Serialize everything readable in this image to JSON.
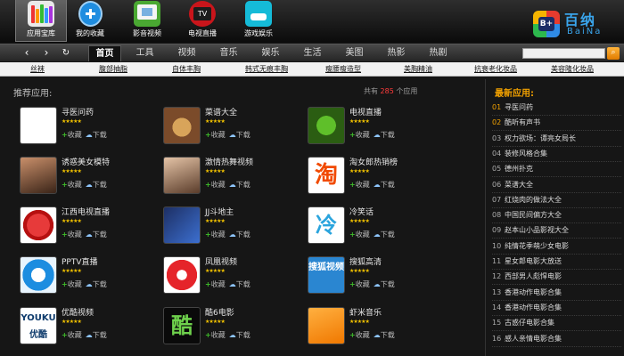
{
  "toolbar": {
    "apps": [
      {
        "label": "应用宝库",
        "icon": "books-icon",
        "active": true
      },
      {
        "label": "我的收藏",
        "icon": "add-favorite-icon"
      },
      {
        "label": "影音视频",
        "icon": "video-icon"
      },
      {
        "label": "电视直播",
        "icon": "tv-icon",
        "badge": "TV"
      },
      {
        "label": "游戏娱乐",
        "icon": "game-icon"
      }
    ],
    "logo": {
      "cn": "百纳",
      "en": "BaiNa",
      "mark": "B+"
    }
  },
  "nav": {
    "back": "‹",
    "forward": "›",
    "refresh": "↻",
    "tabs": [
      "首页",
      "工具",
      "视频",
      "音乐",
      "娱乐",
      "生活",
      "美图",
      "热影",
      "热剧"
    ],
    "active_tab": "首页",
    "search_value": "",
    "search_icon": "search-icon"
  },
  "subnav": [
    "丝袜",
    "腹部抽脂",
    "自体丰胸",
    "韩式无痕丰胸",
    "瘦腰瘦造型",
    "美胸精油",
    "抗衰老化妆品",
    "美容隆化妆品"
  ],
  "recommend": {
    "title": "推荐应用:",
    "count_prefix": "共有",
    "count": "285",
    "count_suffix": "个应用",
    "rating": "★★★★★",
    "fav_label": "收藏",
    "dl_label": "下载",
    "apps": [
      {
        "name": "寻医问药",
        "icon": "medical-icon"
      },
      {
        "name": "菜谱大全",
        "icon": "recipe-icon"
      },
      {
        "name": "电视直播",
        "icon": "tv-live-icon"
      },
      {
        "name": "诱惑美女模特",
        "icon": "model-photo-icon"
      },
      {
        "name": "激情热舞视频",
        "icon": "dance-video-icon"
      },
      {
        "name": "淘女郎热销榜",
        "icon": "taobao-icon",
        "glyph": "淘"
      },
      {
        "name": "江西电视直播",
        "icon": "jiangxi-tv-icon"
      },
      {
        "name": "JJ斗地主",
        "icon": "poker-icon"
      },
      {
        "name": "冷笑话",
        "icon": "cold-joke-icon",
        "glyph": "冷"
      },
      {
        "name": "PPTV直播",
        "icon": "pptv-icon"
      },
      {
        "name": "凤凰视频",
        "icon": "phoenix-icon"
      },
      {
        "name": "搜狐高清",
        "icon": "sohu-video-icon",
        "glyph": "搜狐视频"
      },
      {
        "name": "优酷视频",
        "icon": "youku-icon",
        "glyph": "YOUKU 优酷"
      },
      {
        "name": "酷6电影",
        "icon": "ku6-icon",
        "glyph": "酷"
      },
      {
        "name": "虾米音乐",
        "icon": "xiami-music-icon"
      }
    ]
  },
  "sidebar": {
    "title": "最新应用:",
    "items": [
      {
        "num": "01",
        "label": "寻医问药"
      },
      {
        "num": "02",
        "label": "酷听有声书"
      },
      {
        "num": "03",
        "label": "权力欲场：谭亮女局长"
      },
      {
        "num": "04",
        "label": "装修风格合集"
      },
      {
        "num": "05",
        "label": "德州扑克"
      },
      {
        "num": "06",
        "label": "菜谱大全"
      },
      {
        "num": "07",
        "label": "红烧肉的做法大全"
      },
      {
        "num": "08",
        "label": "中国民间偏方大全"
      },
      {
        "num": "09",
        "label": "赵本山小品影视大全"
      },
      {
        "num": "10",
        "label": "纯情花季萌少女电影"
      },
      {
        "num": "11",
        "label": "星女郎电影大放送"
      },
      {
        "num": "12",
        "label": "西部男人彪悍电影"
      },
      {
        "num": "13",
        "label": "香港动作电影合集"
      },
      {
        "num": "14",
        "label": "香港动作电影合集"
      },
      {
        "num": "15",
        "label": "古惑仔电影合集"
      },
      {
        "num": "16",
        "label": "感人亲情电影合集"
      }
    ]
  },
  "colors": {
    "accent": "#f0a000",
    "count_red": "#ff3b3b",
    "star": "#f2c200",
    "fav_green": "#3fbf2a"
  }
}
